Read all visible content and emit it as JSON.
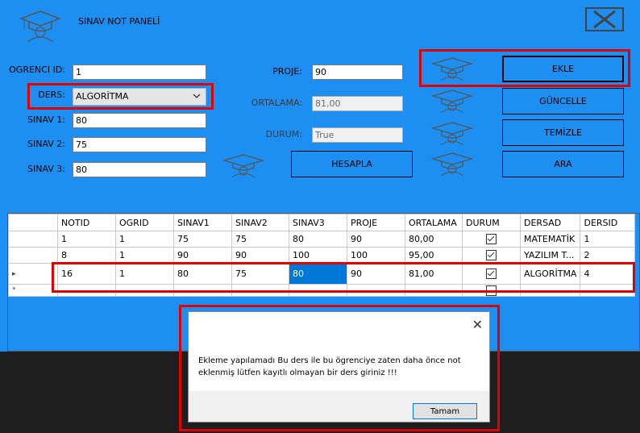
{
  "app": {
    "title": "SINAV NOT PANELİ"
  },
  "form": {
    "ogrenci_id": {
      "label": "OGRENCI ID:",
      "value": "1"
    },
    "ders": {
      "label": "DERS:",
      "value": "ALGORİTMA"
    },
    "sinav1": {
      "label": "SINAV 1:",
      "value": "80"
    },
    "sinav2": {
      "label": "SINAV 2:",
      "value": "75"
    },
    "sinav3": {
      "label": "SINAV 3:",
      "value": "80"
    },
    "proje": {
      "label": "PROJE:",
      "value": "90"
    },
    "ortalama": {
      "label": "ORTALAMA:",
      "value": "81,00"
    },
    "durum": {
      "label": "DURUM:",
      "value": "True"
    }
  },
  "buttons": {
    "hesapla": "HESAPLA",
    "ekle": "EKLE",
    "guncelle": "GÜNCELLE",
    "temizle": "TEMİZLE",
    "ara": "ARA"
  },
  "grid": {
    "columns": [
      "NOTID",
      "OGRID",
      "SINAV1",
      "SINAV2",
      "SINAV3",
      "PROJE",
      "ORTALAMA",
      "DURUM",
      "DERSAD",
      "DERSID"
    ],
    "rows": [
      {
        "notid": "1",
        "ogrid": "1",
        "s1": "75",
        "s2": "75",
        "s3": "80",
        "proje": "90",
        "ort": "80,00",
        "durum": true,
        "dersad": "MATEMATİK",
        "dersid": "1"
      },
      {
        "notid": "8",
        "ogrid": "1",
        "s1": "90",
        "s2": "90",
        "s3": "100",
        "proje": "100",
        "ort": "95,00",
        "durum": true,
        "dersad": "YAZILIM T...",
        "dersid": "2"
      },
      {
        "notid": "16",
        "ogrid": "1",
        "s1": "80",
        "s2": "75",
        "s3": "80",
        "proje": "90",
        "ort": "81,00",
        "durum": true,
        "dersad": "ALGORİTMA",
        "dersid": "4"
      }
    ],
    "row_indicator": "▸",
    "new_row_indicator": "*"
  },
  "dialog": {
    "message": "Ekleme yapılamadı Bu ders ile bu ögrenciye zaten daha önce not eklenmiş lütfen kayıtlı olmayan bir ders giriniz !!!",
    "ok_label": "Tamam",
    "close_glyph": "✕"
  },
  "colors": {
    "form_bg": "#1e8ff2",
    "highlight": "#e00000",
    "selected_cell": "#0078d7"
  },
  "icons": [
    "graduation-cap-icon",
    "close-icon",
    "chevron-down-icon",
    "checkbox-icon"
  ]
}
